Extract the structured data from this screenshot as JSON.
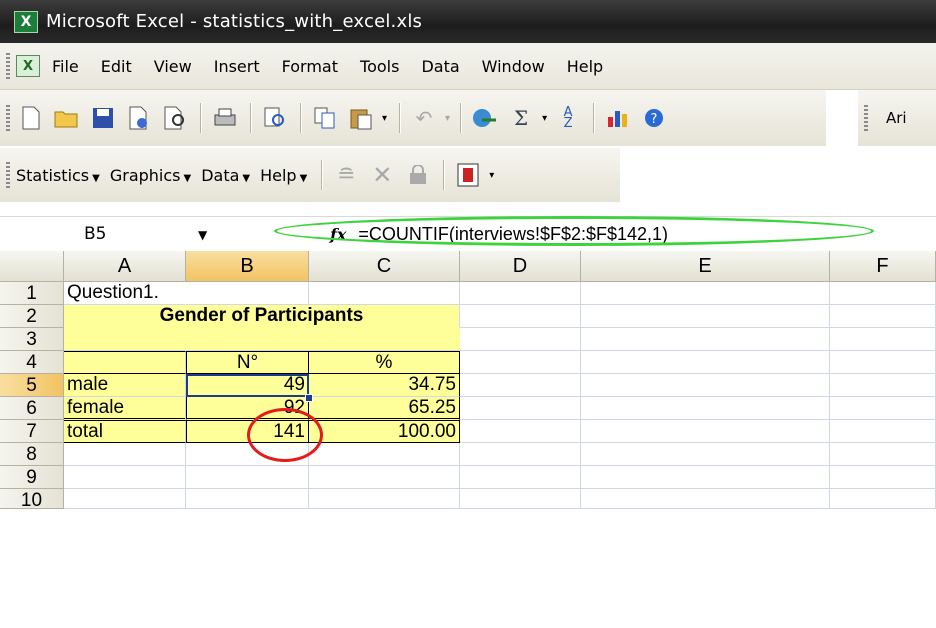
{
  "window": {
    "title": "Microsoft Excel - statistics_with_excel.xls",
    "app_icon": "excel-icon"
  },
  "menu": [
    "File",
    "Edit",
    "View",
    "Insert",
    "Format",
    "Tools",
    "Data",
    "Window",
    "Help"
  ],
  "toolbar": {
    "font_name_partial": "Ari"
  },
  "stats_toolbar": {
    "items": [
      "Statistics",
      "Graphics",
      "Data",
      "Help"
    ]
  },
  "formula_bar": {
    "cell_ref": "B5",
    "fx_label": "fx",
    "formula": "=COUNTIF(interviews!$F$2:$F$142,1)"
  },
  "columns": [
    "A",
    "B",
    "C",
    "D",
    "E",
    "F"
  ],
  "rows": [
    "1",
    "2",
    "3",
    "4",
    "5",
    "6",
    "7",
    "8",
    "9",
    "10"
  ],
  "cells": {
    "A1": "Question1.",
    "A2": "Gender of Participants",
    "B4": "N°",
    "C4": "%",
    "A5": "male",
    "B5": "49",
    "C5": "34.75",
    "A6": "female",
    "B6": "92",
    "C6": "65.25",
    "A7": "total",
    "B7": "141",
    "C7": "100.00"
  },
  "annotations": {
    "green_oval_color": "#3dd33d",
    "red_oval_color": "#e41b1b"
  }
}
